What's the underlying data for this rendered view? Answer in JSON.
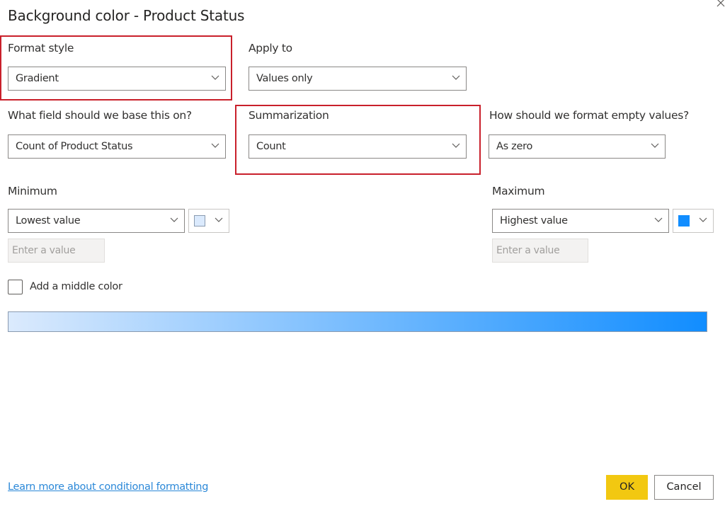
{
  "dialog": {
    "title": "Background color - Product Status",
    "close_icon": "close-icon"
  },
  "format_style": {
    "label": "Format style",
    "value": "Gradient",
    "highlighted": true
  },
  "apply_to": {
    "label": "Apply to",
    "value": "Values only"
  },
  "base_field": {
    "label": "What field should we base this on?",
    "value": "Count of Product Status"
  },
  "summarization": {
    "label": "Summarization",
    "value": "Count",
    "highlighted": true
  },
  "empty_values": {
    "label": "How should we format empty values?",
    "value": "As zero"
  },
  "minimum": {
    "label": "Minimum",
    "value": "Lowest value",
    "color": "#dbeafd",
    "input_placeholder": "Enter a value"
  },
  "maximum": {
    "label": "Maximum",
    "value": "Highest value",
    "color": "#118dff",
    "input_placeholder": "Enter a value"
  },
  "middle_color": {
    "label": "Add a middle color",
    "checked": false
  },
  "gradient": {
    "start_color": "#dbeafd",
    "end_color": "#118dff"
  },
  "footer": {
    "link_text": "Learn more about conditional formatting",
    "ok_label": "OK",
    "cancel_label": "Cancel"
  },
  "colors": {
    "highlight_border": "#c9202b",
    "ok_button": "#f2c811",
    "link": "#2b88d8"
  }
}
